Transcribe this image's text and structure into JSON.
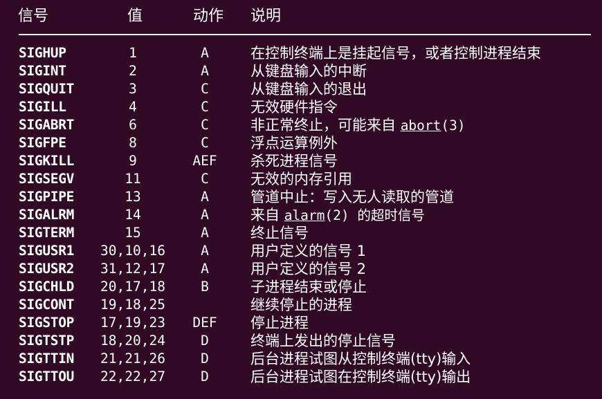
{
  "header": {
    "name": "信号",
    "value": "值",
    "action": "动作",
    "description": "说明"
  },
  "rows": [
    {
      "name": "SIGHUP",
      "value": "1",
      "action": "A",
      "desc": "在控制终端上是挂起信号，或者控制进程结束"
    },
    {
      "name": "SIGINT",
      "value": "2",
      "action": "A",
      "desc": "从键盘输入的中断"
    },
    {
      "name": "SIGQUIT",
      "value": "3",
      "action": "C",
      "desc": "从键盘输入的退出"
    },
    {
      "name": "SIGILL",
      "value": "4",
      "action": "C",
      "desc": "无效硬件指令"
    },
    {
      "name": "SIGABRT",
      "value": "6",
      "action": "C",
      "desc_pre": "非正常终止，可能来自 ",
      "desc_link": "abort",
      "desc_post": "(3)"
    },
    {
      "name": "SIGFPE",
      "value": "8",
      "action": "C",
      "desc": "浮点运算例外"
    },
    {
      "name": "SIGKILL",
      "value": "9",
      "action": "AEF",
      "desc": "杀死进程信号"
    },
    {
      "name": "SIGSEGV",
      "value": "11",
      "action": "C",
      "desc": "无效的内存引用"
    },
    {
      "name": "SIGPIPE",
      "value": "13",
      "action": "A",
      "desc": "管道中止：写入无人读取的管道"
    },
    {
      "name": "SIGALRM",
      "value": "14",
      "action": "A",
      "desc_pre": "来自 ",
      "desc_link": "alarm",
      "desc_post": "(2) 的超时信号"
    },
    {
      "name": "SIGTERM",
      "value": "15",
      "action": "A",
      "desc": "终止信号"
    },
    {
      "name": "SIGUSR1",
      "value": "30,10,16",
      "action": "A",
      "desc": "用户定义的信号 1"
    },
    {
      "name": "SIGUSR2",
      "value": "31,12,17",
      "action": "A",
      "desc": "用户定义的信号 2"
    },
    {
      "name": "SIGCHLD",
      "value": "20,17,18",
      "action": "B",
      "desc": "子进程结束或停止"
    },
    {
      "name": "SIGCONT",
      "value": "19,18,25",
      "action": "",
      "desc": "继续停止的进程"
    },
    {
      "name": "SIGSTOP",
      "value": "17,19,23",
      "action": "DEF",
      "desc": "停止进程"
    },
    {
      "name": "SIGTSTP",
      "value": "18,20,24",
      "action": "D",
      "desc": "终端上发出的停止信号"
    },
    {
      "name": "SIGTTIN",
      "value": "21,21,26",
      "action": "D",
      "desc": "后台进程试图从控制终端(tty)输入"
    },
    {
      "name": "SIGTTOU",
      "value": "22,22,27",
      "action": "D",
      "desc": "后台进程试图在控制终端(tty)输出"
    }
  ],
  "colors": {
    "background": "#300a24",
    "text": "#ffffff"
  }
}
